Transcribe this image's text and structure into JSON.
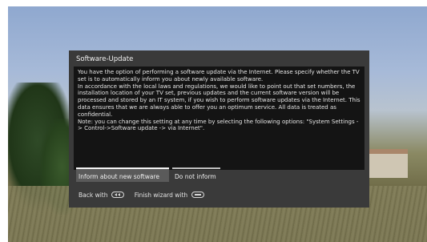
{
  "dialog": {
    "title": "Software-Update",
    "body": [
      "You have the option of performing a software update via the Internet. Please specify whether the TV set is to automatically inform you about newly available software.",
      "In accordance with the local laws and regulations, we would like to point out that set numbers, the installation location of your TV set, previous updates and the current software version will be processed and stored by an IT system, if you wish to perform software updates via the Internet. This data ensures that we are always able to offer you an optimum service. All data is treated as confidential.",
      "Note: you can change this setting at any time by selecting the following options: \"System Settings -> Control->Software update -> via Internet\"."
    ],
    "buttons": {
      "inform": "Inform about new software",
      "not_inform": "Do not inform"
    },
    "footer": {
      "back_label": "Back with",
      "back_icon": "rewind-key-icon",
      "finish_label": "Finish wizard with",
      "finish_icon": "back-key-icon"
    }
  },
  "colors": {
    "dialog_bg": "#3a3a3a",
    "content_bg": "#141414",
    "selected_button_bg": "#5a5a5a",
    "text": "#e6e6e6"
  }
}
